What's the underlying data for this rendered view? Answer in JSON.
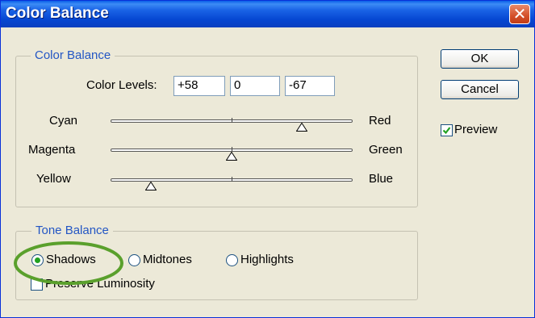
{
  "window": {
    "title": "Color Balance",
    "close_icon": "close-icon"
  },
  "color_balance": {
    "legend": "Color Balance",
    "levels_label": "Color Levels:",
    "levels": [
      "+58",
      "0",
      "-67"
    ],
    "sliders": [
      {
        "left": "Cyan",
        "right": "Red",
        "value": 58
      },
      {
        "left": "Magenta",
        "right": "Green",
        "value": 0
      },
      {
        "left": "Yellow",
        "right": "Blue",
        "value": -67
      }
    ]
  },
  "tone_balance": {
    "legend": "Tone Balance",
    "options": [
      "Shadows",
      "Midtones",
      "Highlights"
    ],
    "selected": "Shadows",
    "preserve_label": "Preserve Luminosity",
    "preserve_checked": false
  },
  "buttons": {
    "ok": "OK",
    "cancel": "Cancel"
  },
  "preview": {
    "label": "Preview",
    "checked": true
  },
  "colors": {
    "title_bar": "#0a5fe8",
    "legend_text": "#2356c4",
    "highlight_ellipse": "#5aa02c"
  }
}
